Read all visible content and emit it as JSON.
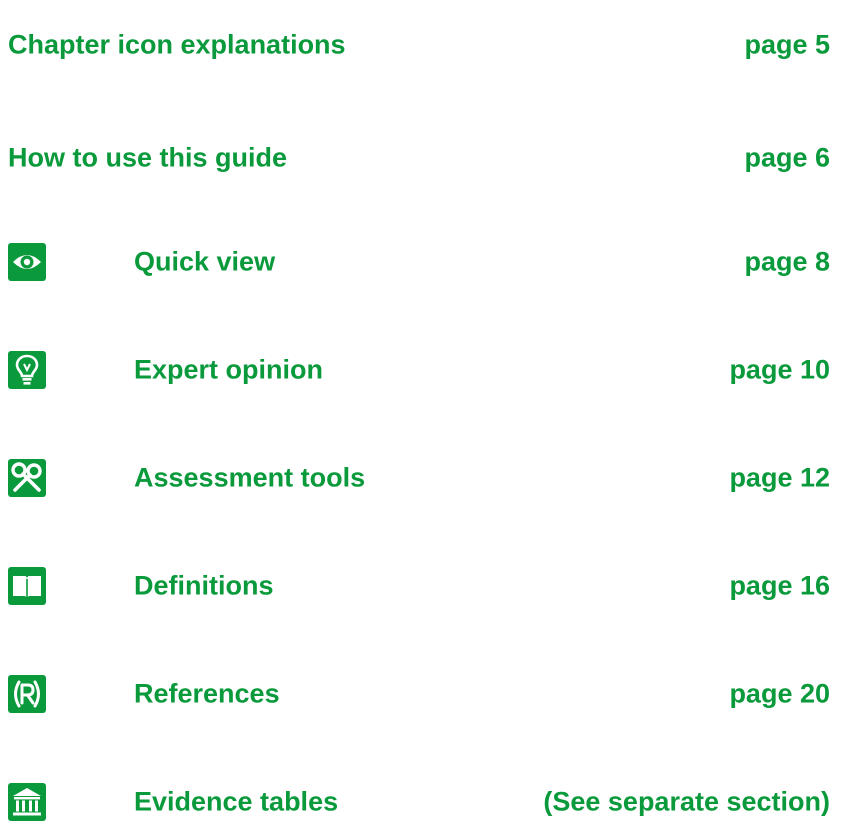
{
  "accent": "#0a9a3c",
  "toc": [
    {
      "title": "Chapter icon explanations",
      "page": "page 5",
      "icon": ""
    },
    {
      "title": "How to use this guide",
      "page": "page 6",
      "icon": ""
    },
    {
      "title": "Quick view",
      "page": "page 8",
      "icon": "eye-icon"
    },
    {
      "title": "Expert opinion",
      "page": "page 10",
      "icon": "lightbulb-icon"
    },
    {
      "title": "Assessment tools",
      "page": "page 12",
      "icon": "tools-icon"
    },
    {
      "title": "Definitions",
      "page": "page 16",
      "icon": "open-book-icon"
    },
    {
      "title": "References",
      "page": "page 20",
      "icon": "references-r-icon"
    },
    {
      "title": "Evidence tables",
      "page": "(See separate section)",
      "icon": "building-icon"
    }
  ]
}
